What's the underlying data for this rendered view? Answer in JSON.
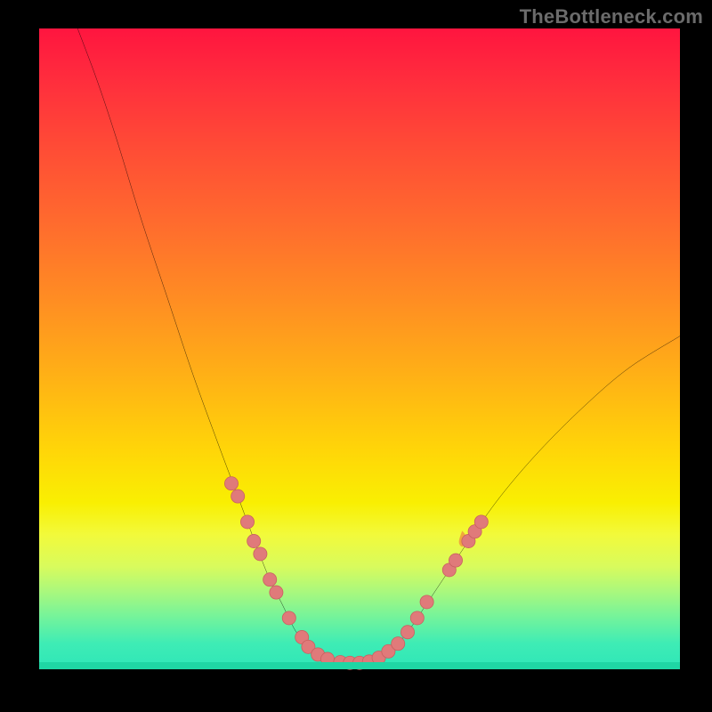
{
  "watermark": "TheBottleneck.com",
  "chart_data": {
    "type": "line",
    "title": "",
    "xlabel": "",
    "ylabel": "",
    "xlim": [
      0,
      100
    ],
    "ylim": [
      0,
      100
    ],
    "grid": false,
    "legend": false,
    "curve_points": [
      {
        "x": 6,
        "y": 100
      },
      {
        "x": 9,
        "y": 92
      },
      {
        "x": 12,
        "y": 83
      },
      {
        "x": 16,
        "y": 70
      },
      {
        "x": 20,
        "y": 58
      },
      {
        "x": 24,
        "y": 46
      },
      {
        "x": 28,
        "y": 35
      },
      {
        "x": 31,
        "y": 27
      },
      {
        "x": 34,
        "y": 19
      },
      {
        "x": 36,
        "y": 14
      },
      {
        "x": 38,
        "y": 10
      },
      {
        "x": 40,
        "y": 6
      },
      {
        "x": 42,
        "y": 3.5
      },
      {
        "x": 44,
        "y": 2
      },
      {
        "x": 46,
        "y": 1.2
      },
      {
        "x": 48,
        "y": 1
      },
      {
        "x": 50,
        "y": 1
      },
      {
        "x": 52,
        "y": 1.4
      },
      {
        "x": 54,
        "y": 2.5
      },
      {
        "x": 56,
        "y": 4
      },
      {
        "x": 58,
        "y": 6.5
      },
      {
        "x": 60,
        "y": 9.5
      },
      {
        "x": 63,
        "y": 14
      },
      {
        "x": 67,
        "y": 20
      },
      {
        "x": 72,
        "y": 27
      },
      {
        "x": 78,
        "y": 34
      },
      {
        "x": 85,
        "y": 41
      },
      {
        "x": 92,
        "y": 47
      },
      {
        "x": 100,
        "y": 52
      }
    ],
    "markers": [
      {
        "x": 30,
        "y": 29
      },
      {
        "x": 31,
        "y": 27
      },
      {
        "x": 32.5,
        "y": 23
      },
      {
        "x": 33.5,
        "y": 20
      },
      {
        "x": 34.5,
        "y": 18
      },
      {
        "x": 36,
        "y": 14
      },
      {
        "x": 37,
        "y": 12
      },
      {
        "x": 39,
        "y": 8
      },
      {
        "x": 41,
        "y": 5
      },
      {
        "x": 42,
        "y": 3.5
      },
      {
        "x": 43.5,
        "y": 2.3
      },
      {
        "x": 45,
        "y": 1.6
      },
      {
        "x": 47,
        "y": 1.1
      },
      {
        "x": 48.5,
        "y": 1
      },
      {
        "x": 50,
        "y": 1
      },
      {
        "x": 51.5,
        "y": 1.2
      },
      {
        "x": 53,
        "y": 1.8
      },
      {
        "x": 54.5,
        "y": 2.8
      },
      {
        "x": 56,
        "y": 4
      },
      {
        "x": 57.5,
        "y": 5.8
      },
      {
        "x": 59,
        "y": 8
      },
      {
        "x": 60.5,
        "y": 10.5
      },
      {
        "x": 64,
        "y": 15.5
      },
      {
        "x": 65,
        "y": 17
      },
      {
        "x": 67,
        "y": 20
      },
      {
        "x": 68,
        "y": 21.5
      },
      {
        "x": 69,
        "y": 23
      }
    ],
    "flame_position": {
      "x": 66,
      "y": 20
    },
    "notes": "Axes are unlabeled in the source image; values are normalized 0–100 on both axes estimated from pixel positions. Curve resembles a bottleneck/V-shape with minimum near x≈48."
  }
}
